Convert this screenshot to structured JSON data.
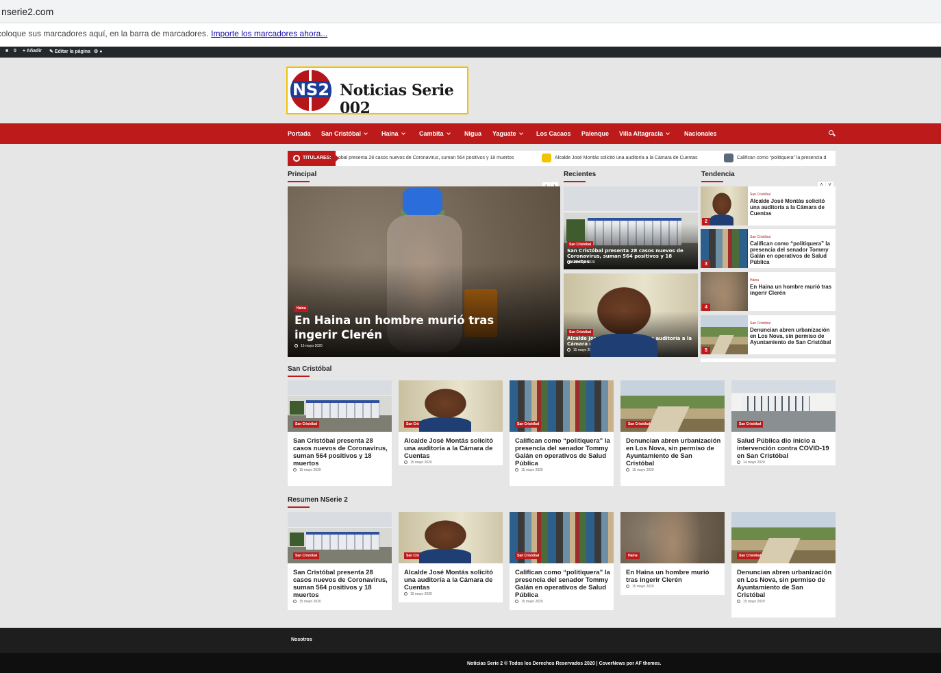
{
  "browser": {
    "url": "nserie2.com",
    "bookmarks_hint": "coloque sus marcadores aquí, en la barra de marcadores.",
    "bookmarks_link": "Importe los marcadores ahora..."
  },
  "admin_bar": {
    "comments": "0",
    "add": "Añadir",
    "edit": "Editar la página"
  },
  "site": {
    "logo_mark": "NS2",
    "name": "Noticias Serie 002"
  },
  "nav": {
    "items": [
      {
        "label": "Portada",
        "dropdown": false
      },
      {
        "label": "San Cristóbal",
        "dropdown": true
      },
      {
        "label": "Haina",
        "dropdown": true
      },
      {
        "label": "Cambita",
        "dropdown": true
      },
      {
        "label": "Nigua",
        "dropdown": false
      },
      {
        "label": "Yaguate",
        "dropdown": true
      },
      {
        "label": "Los Cacaos",
        "dropdown": false
      },
      {
        "label": "Palenque",
        "dropdown": false
      },
      {
        "label": "Villa Altagracia",
        "dropdown": true
      },
      {
        "label": "Nacionales",
        "dropdown": false
      }
    ]
  },
  "ticker": {
    "label": "TITULARES:",
    "items": [
      "obal presenta 28 casos nuevos de Coronavirus, suman 564 positivos y 18 muertos",
      "Alcalde José Montás solicitó una auditoría a la Cámara de Cuentas",
      "Califican como “politiquera” la presencia d"
    ]
  },
  "sections": {
    "principal": "Principal",
    "recientes": "Recientes",
    "tendencia": "Tendencia",
    "san_cristobal": "San Cristóbal",
    "resumen": "Resumen NSerie 2"
  },
  "main_story": {
    "category": "Haina",
    "title": "En Haina un hombre murió tras ingerir Clerén",
    "date": "15 mayo 2020"
  },
  "recent": [
    {
      "category": "San Cristóbal",
      "title": "San Cristóbal presenta 28 casos nuevos de Coronavirus, suman 564 positivos y 18 muertos",
      "date": "15 mayo 2020"
    },
    {
      "category": "San Cristóbal",
      "title": "Alcalde José Montás solicitó una auditoría a la Cámara de Cuentas",
      "date": "15 mayo 2020"
    }
  ],
  "trending": [
    {
      "num": "2",
      "category": "San Cristóbal",
      "title": "Alcalde José Montás solicitó una auditoría a la Cámara de Cuentas"
    },
    {
      "num": "3",
      "category": "San Cristóbal",
      "title": "Califican como “politiquera” la presencia del senador Tommy Galán en operativos de Salud Pública"
    },
    {
      "num": "4",
      "category": "Haina",
      "title": "En Haina un hombre murió tras ingerir Clerén"
    },
    {
      "num": "5",
      "category": "San Cristóbal",
      "title": "Denuncian abren urbanización en Los Nova, sin permiso de Ayuntamiento de San Cristóbal"
    }
  ],
  "san_cristobal_cards": [
    {
      "category": "San Cristóbal",
      "title": "San Cristóbal presenta 28 casos nuevos de Coronavirus, suman 564 positivos y 18 muertos",
      "date": "15 mayo 2020"
    },
    {
      "category": "San Cristóbal",
      "title": "Alcalde José Montás solicitó una auditoría a la Cámara de Cuentas",
      "date": "15 mayo 2020"
    },
    {
      "category": "San Cristóbal",
      "title": "Califican como “politiquera” la presencia del senador Tommy Galán en operativos de Salud Pública",
      "date": "15 mayo 2020"
    },
    {
      "category": "San Cristóbal",
      "title": "Denuncian abren urbanización en Los Nova, sin permiso de Ayuntamiento de San Cristóbal",
      "date": "15 mayo 2020"
    },
    {
      "category": "San Cristóbal",
      "title": "Salud Pública dio inicio a intervención contra COVID-19 en San Cristóbal",
      "date": "14 mayo 2020"
    }
  ],
  "resumen_cards": [
    {
      "category": "San Cristóbal",
      "title": "San Cristóbal presenta 28 casos nuevos de Coronavirus, suman 564 positivos y 18 muertos",
      "date": "15 mayo 2020"
    },
    {
      "category": "San Cristóbal",
      "title": "Alcalde José Montás solicitó una auditoría a la Cámara de Cuentas",
      "date": "15 mayo 2020"
    },
    {
      "category": "San Cristóbal",
      "title": "Califican como “politiquera” la presencia del senador Tommy Galán en operativos de Salud Pública",
      "date": "15 mayo 2020"
    },
    {
      "category": "Haina",
      "title": "En Haina un hombre murió tras ingerir Clerén",
      "date": "15 mayo 2020"
    },
    {
      "category": "San Cristóbal",
      "title": "Denuncian abren urbanización en Los Nova, sin permiso de Ayuntamiento de San Cristóbal",
      "date": "15 mayo 2020"
    }
  ],
  "footer": {
    "menu": "Nosotros",
    "copyright": "Noticias Serie 2 © Todos los Derechos Reservados 2020 | CoverNews por AF themes."
  },
  "colors": {
    "accent": "#bd1b1b",
    "logo_border": "#f2c400",
    "footer": "#1e1e1e"
  }
}
